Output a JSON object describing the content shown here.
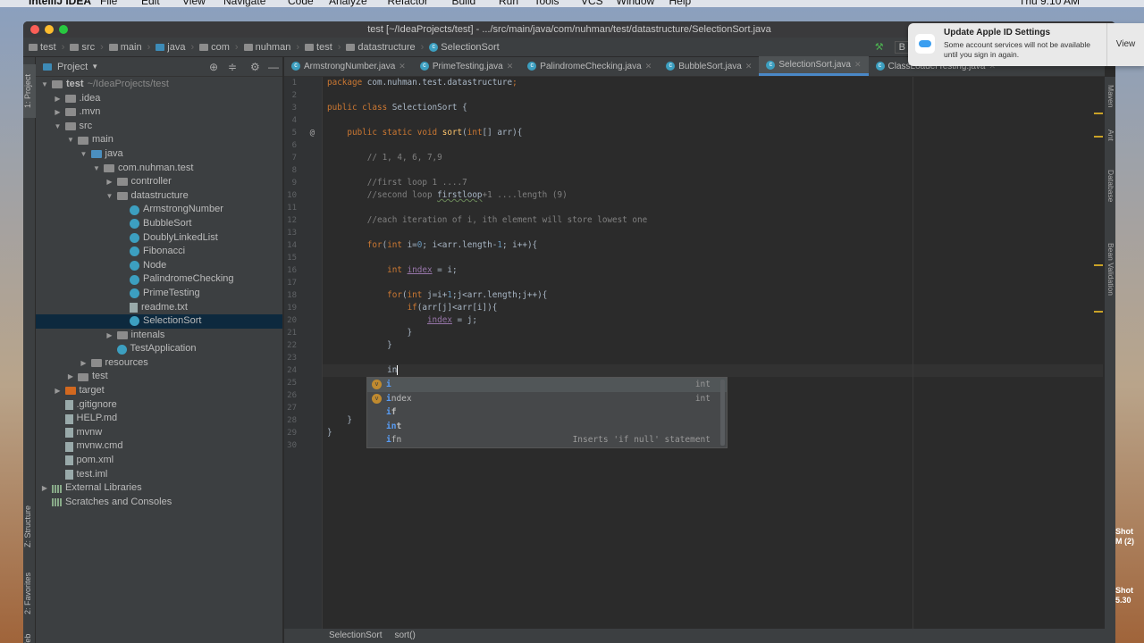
{
  "menubar": {
    "app": "IntelliJ IDEA",
    "items": [
      "File",
      "Edit",
      "View",
      "Navigate",
      "Code",
      "Analyze",
      "Refactor",
      "Build",
      "Run",
      "Tools",
      "VCS",
      "Window",
      "Help"
    ],
    "clock": "Thu 9:10 AM"
  },
  "window": {
    "title": "test [~/IdeaProjects/test] - .../src/main/java/com/nuhman/test/datastructure/SelectionSort.java"
  },
  "breadcrumbs": [
    "test",
    "src",
    "main",
    "java",
    "com",
    "nuhman",
    "test",
    "datastructure",
    "SelectionSort"
  ],
  "toolbar": {
    "build_config": "B"
  },
  "project_panel": {
    "title": "Project",
    "stripe_labels": [
      "1: Project",
      "Z: Structure",
      "2: Favorites",
      "Web"
    ],
    "tree": [
      {
        "label": "test",
        "extra": "~/IdeaProjects/test",
        "level": 0,
        "arrow": "down",
        "icon": "folder"
      },
      {
        "label": ".idea",
        "level": 1,
        "arrow": "right",
        "icon": "folder"
      },
      {
        "label": ".mvn",
        "level": 1,
        "arrow": "right",
        "icon": "folder"
      },
      {
        "label": "src",
        "level": 1,
        "arrow": "down",
        "icon": "folder"
      },
      {
        "label": "main",
        "level": 2,
        "arrow": "down",
        "icon": "folder"
      },
      {
        "label": "java",
        "level": 3,
        "arrow": "down",
        "icon": "src"
      },
      {
        "label": "com.nuhman.test",
        "level": 4,
        "arrow": "down",
        "icon": "pkg"
      },
      {
        "label": "controller",
        "level": 5,
        "arrow": "right",
        "icon": "pkg"
      },
      {
        "label": "datastructure",
        "level": 5,
        "arrow": "down",
        "icon": "pkg"
      },
      {
        "label": "ArmstrongNumber",
        "level": 6,
        "arrow": "",
        "icon": "class"
      },
      {
        "label": "BubbleSort",
        "level": 6,
        "arrow": "",
        "icon": "class"
      },
      {
        "label": "DoublyLinkedList",
        "level": 6,
        "arrow": "",
        "icon": "class"
      },
      {
        "label": "Fibonacci",
        "level": 6,
        "arrow": "",
        "icon": "class"
      },
      {
        "label": "Node",
        "level": 6,
        "arrow": "",
        "icon": "class"
      },
      {
        "label": "PalindromeChecking",
        "level": 6,
        "arrow": "",
        "icon": "class"
      },
      {
        "label": "PrimeTesting",
        "level": 6,
        "arrow": "",
        "icon": "class"
      },
      {
        "label": "readme.txt",
        "level": 6,
        "arrow": "",
        "icon": "file"
      },
      {
        "label": "SelectionSort",
        "level": 6,
        "arrow": "",
        "icon": "class",
        "selected": true
      },
      {
        "label": "intenals",
        "level": 5,
        "arrow": "right",
        "icon": "pkg"
      },
      {
        "label": "TestApplication",
        "level": 5,
        "arrow": "",
        "icon": "class"
      },
      {
        "label": "resources",
        "level": 3,
        "arrow": "right",
        "icon": "folder"
      },
      {
        "label": "test",
        "level": 2,
        "arrow": "right",
        "icon": "folder"
      },
      {
        "label": "target",
        "level": 1,
        "arrow": "right",
        "icon": "excl"
      },
      {
        "label": ".gitignore",
        "level": 1,
        "arrow": "",
        "icon": "file"
      },
      {
        "label": "HELP.md",
        "level": 1,
        "arrow": "",
        "icon": "file"
      },
      {
        "label": "mvnw",
        "level": 1,
        "arrow": "",
        "icon": "file"
      },
      {
        "label": "mvnw.cmd",
        "level": 1,
        "arrow": "",
        "icon": "file"
      },
      {
        "label": "pom.xml",
        "level": 1,
        "arrow": "",
        "icon": "file"
      },
      {
        "label": "test.iml",
        "level": 1,
        "arrow": "",
        "icon": "file"
      },
      {
        "label": "External Libraries",
        "level": 0,
        "arrow": "right",
        "icon": "lib"
      },
      {
        "label": "Scratches and Consoles",
        "level": 0,
        "arrow": "",
        "icon": "lib"
      }
    ]
  },
  "tabs": [
    {
      "label": "ArmstrongNumber.java"
    },
    {
      "label": "PrimeTesting.java"
    },
    {
      "label": "PalindromeChecking.java"
    },
    {
      "label": "BubbleSort.java"
    },
    {
      "label": "SelectionSort.java",
      "active": true
    },
    {
      "label": "ClassLoaderTesting.java"
    }
  ],
  "editor": {
    "current_line": 24,
    "lines": [
      [
        [
          "kw",
          "package "
        ],
        [
          "",
          "com.nuhman.test.datastructure"
        ],
        [
          "kw",
          ";"
        ]
      ],
      [],
      [
        [
          "kw",
          "public class "
        ],
        [
          "",
          "SelectionSort {"
        ]
      ],
      [],
      [
        [
          "",
          "    "
        ],
        [
          "kw",
          "public static void "
        ],
        [
          "fn",
          "sort"
        ],
        [
          "",
          "("
        ],
        [
          "kw",
          "int"
        ],
        [
          "",
          "[] arr){"
        ]
      ],
      [],
      [
        [
          "cm",
          "        // 1, 4, 6, 7,9"
        ]
      ],
      [],
      [
        [
          "cm",
          "        //first loop 1 ....7"
        ]
      ],
      [
        [
          "cm",
          "        //second loop "
        ],
        [
          "grn",
          "firstloop"
        ],
        [
          "cm",
          "+1 ....length (9)"
        ]
      ],
      [],
      [
        [
          "cm",
          "        //each iteration of i, ith element will store lowest one"
        ]
      ],
      [],
      [
        [
          "",
          "        "
        ],
        [
          "kw",
          "for"
        ],
        [
          "",
          "("
        ],
        [
          "kw",
          "int "
        ],
        [
          "",
          "i="
        ],
        [
          "num",
          "0"
        ],
        [
          "",
          "; i<arr.length-"
        ],
        [
          "num",
          "1"
        ],
        [
          "",
          "; i++){"
        ]
      ],
      [],
      [
        [
          "",
          "            "
        ],
        [
          "kw",
          "int "
        ],
        [
          "var",
          "index"
        ],
        [
          "",
          " = i;"
        ]
      ],
      [],
      [
        [
          "",
          "            "
        ],
        [
          "kw",
          "for"
        ],
        [
          "",
          "("
        ],
        [
          "kw",
          "int "
        ],
        [
          "",
          "j=i+"
        ],
        [
          "num",
          "1"
        ],
        [
          "",
          ";j<arr.length;j++){"
        ]
      ],
      [
        [
          "",
          "                "
        ],
        [
          "kw",
          "if"
        ],
        [
          "",
          "(arr[j]<arr[i]){"
        ]
      ],
      [
        [
          "",
          "                    "
        ],
        [
          "var",
          "index"
        ],
        [
          "",
          " = j;"
        ]
      ],
      [
        [
          "",
          "                }"
        ]
      ],
      [
        [
          "",
          "            }"
        ]
      ],
      [],
      [
        [
          "",
          "            in"
        ]
      ],
      [],
      [],
      [],
      [
        [
          "",
          "    }"
        ]
      ],
      [
        [
          "",
          "}"
        ]
      ],
      []
    ]
  },
  "completion": {
    "items": [
      {
        "match": "i",
        "rest": "",
        "badge": "v",
        "type": "int",
        "selected": true
      },
      {
        "match": "i",
        "rest": "ndex",
        "badge": "v",
        "type": "int"
      },
      {
        "match": "i",
        "rest": "f",
        "badge": "",
        "type": ""
      },
      {
        "match": "in",
        "rest": "t",
        "badge": "",
        "type": ""
      },
      {
        "match": "i",
        "rest": "fn",
        "badge": "",
        "type": "Inserts 'if null' statement"
      }
    ]
  },
  "right_stripe": [
    "Maven",
    "Ant",
    "Database",
    "Bean Validation"
  ],
  "status_bar": {
    "crumbs": [
      "SelectionSort",
      "sort()"
    ]
  },
  "notification": {
    "title": "Update Apple ID Settings",
    "body": "Some account services will not be available until you sign in again.",
    "action": "View"
  },
  "desktop": {
    "file1": [
      "Shot",
      "M (2)"
    ],
    "file2": [
      "Shot",
      "5.30"
    ]
  }
}
